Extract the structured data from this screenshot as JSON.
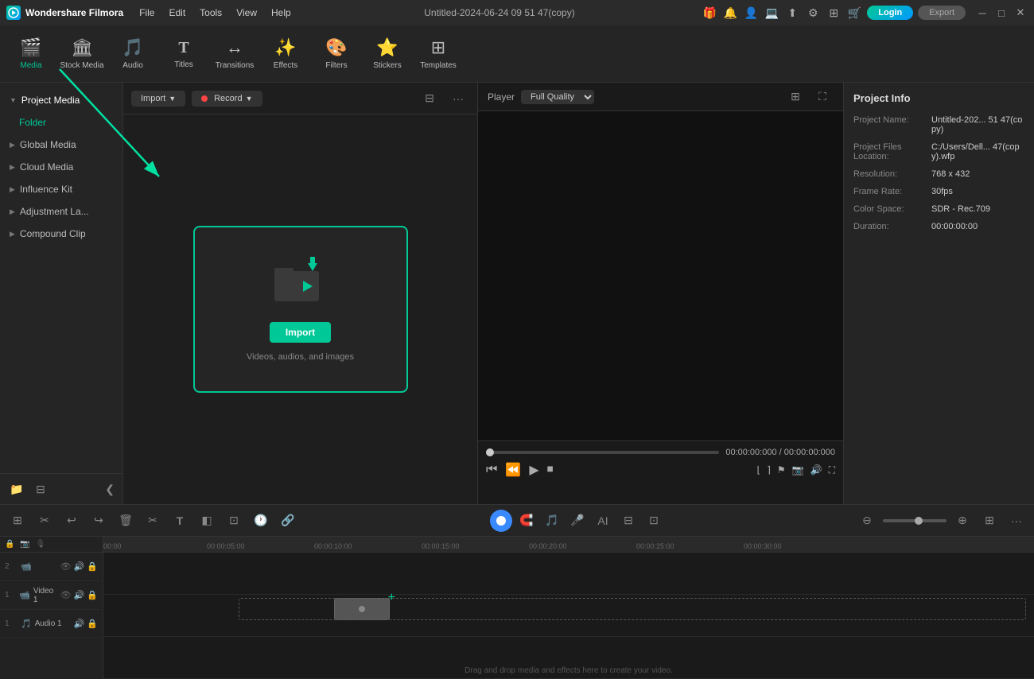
{
  "titlebar": {
    "app_name": "Wondershare Filmora",
    "title": "Untitled-2024-06-24 09 51 47(copy)",
    "login_label": "Login",
    "export_label": "Export"
  },
  "menu": {
    "items": [
      "File",
      "Edit",
      "Tools",
      "View",
      "Help"
    ]
  },
  "toolbar": {
    "items": [
      {
        "id": "media",
        "label": "Media",
        "icon": "🎬",
        "active": true
      },
      {
        "id": "stock",
        "label": "Stock Media",
        "icon": "🏛",
        "active": false
      },
      {
        "id": "audio",
        "label": "Audio",
        "icon": "🎵",
        "active": false
      },
      {
        "id": "titles",
        "label": "Titles",
        "icon": "T",
        "active": false
      },
      {
        "id": "transitions",
        "label": "Transitions",
        "icon": "↔",
        "active": false
      },
      {
        "id": "effects",
        "label": "Effects",
        "icon": "✨",
        "active": false
      },
      {
        "id": "filters",
        "label": "Filters",
        "icon": "🔧",
        "active": false
      },
      {
        "id": "stickers",
        "label": "Stickers",
        "icon": "⭐",
        "active": false
      },
      {
        "id": "templates",
        "label": "Templates",
        "icon": "⊞",
        "active": false
      }
    ]
  },
  "sidebar": {
    "items": [
      {
        "id": "project-media",
        "label": "Project Media",
        "active": true
      },
      {
        "id": "folder",
        "label": "Folder",
        "is_folder": true
      },
      {
        "id": "global-media",
        "label": "Global Media"
      },
      {
        "id": "cloud-media",
        "label": "Cloud Media"
      },
      {
        "id": "influence-kit",
        "label": "Influence Kit"
      },
      {
        "id": "adjustment-la",
        "label": "Adjustment La..."
      },
      {
        "id": "compound-clip",
        "label": "Compound Clip"
      }
    ]
  },
  "media_toolbar": {
    "import_label": "Import",
    "record_label": "Record"
  },
  "import_area": {
    "button_label": "Import",
    "hint": "Videos, audios, and images"
  },
  "player": {
    "label": "Player",
    "quality": "Full Quality",
    "time_current": "00:00:00:000",
    "time_total": "00:00:00:000"
  },
  "project_info": {
    "title": "Project Info",
    "project_name_label": "Project Name:",
    "project_name_value": "Untitled-202... 51 47(copy)",
    "files_location_label": "Project Files Location:",
    "files_location_value": "C:/Users/Dell... 47(copy).wfp",
    "resolution_label": "Resolution:",
    "resolution_value": "768 x 432",
    "frame_rate_label": "Frame Rate:",
    "frame_rate_value": "30fps",
    "color_space_label": "Color Space:",
    "color_space_value": "SDR - Rec.709",
    "duration_label": "Duration:",
    "duration_value": "00:00:00:00"
  },
  "timeline": {
    "tracks": [
      {
        "num": "",
        "icon": "▶",
        "name": "",
        "controls": [
          "⊞",
          "⊟",
          "▶"
        ],
        "type": "ruler"
      },
      {
        "num": "2",
        "icon": "🔊",
        "name": "",
        "controls": [
          "↔",
          "▶"
        ],
        "type": "audio"
      },
      {
        "num": "1",
        "icon": "📹",
        "name": "Video 1",
        "controls": [
          "↔",
          "▶",
          "👁"
        ],
        "type": "video"
      },
      {
        "num": "1",
        "icon": "🎵",
        "name": "Audio 1",
        "controls": [
          "↔",
          "🔊"
        ],
        "type": "audio2"
      }
    ],
    "ruler_marks": [
      "00:00",
      "00:00:05:00",
      "00:00:10:00",
      "00:00:15:00",
      "00:00:20:00",
      "00:00:25:00",
      "00:00:30:00"
    ],
    "drop_hint": "Drag and drop media and effects here to create your video."
  }
}
